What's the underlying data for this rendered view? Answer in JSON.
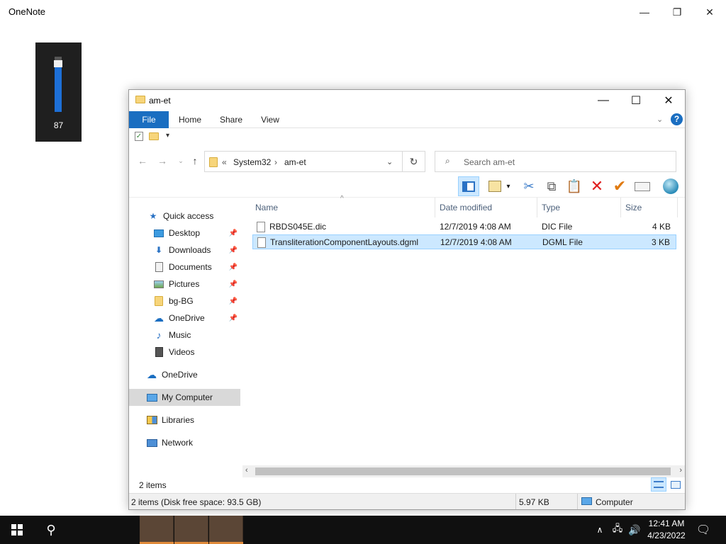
{
  "app": {
    "title": "OneNote"
  },
  "volume": {
    "level": 87,
    "label": "87"
  },
  "explorer": {
    "title": "am-et",
    "tabs": [
      "File",
      "Home",
      "Share",
      "View"
    ],
    "breadcrumb": {
      "overflow": "«",
      "items": [
        "System32",
        "am-et"
      ]
    },
    "search_placeholder": "Search am-et",
    "columns": [
      "Name",
      "Date modified",
      "Type",
      "Size"
    ],
    "nav": [
      {
        "label": "Quick access",
        "icon": "star-icon",
        "pinned": false
      },
      {
        "label": "Desktop",
        "icon": "desktop-icon",
        "pinned": true
      },
      {
        "label": "Downloads",
        "icon": "download-arrow-icon",
        "pinned": true
      },
      {
        "label": "Documents",
        "icon": "documents-icon",
        "pinned": true
      },
      {
        "label": "Pictures",
        "icon": "pictures-icon",
        "pinned": true
      },
      {
        "label": "bg-BG",
        "icon": "folder-icon",
        "pinned": true
      },
      {
        "label": "OneDrive",
        "icon": "cloud-icon",
        "pinned": true
      },
      {
        "label": "Music",
        "icon": "music-note-icon",
        "pinned": false
      },
      {
        "label": "Videos",
        "icon": "film-icon",
        "pinned": false
      },
      {
        "label": "OneDrive",
        "icon": "cloud-icon",
        "pinned": false
      },
      {
        "label": "My Computer",
        "icon": "computer-icon",
        "pinned": false,
        "selected": true
      },
      {
        "label": "Libraries",
        "icon": "libraries-icon",
        "pinned": false
      },
      {
        "label": "Network",
        "icon": "network-icon",
        "pinned": false
      }
    ],
    "files": [
      {
        "name": "RBDS045E.dic",
        "date": "12/7/2019 4:08 AM",
        "type": "DIC File",
        "size": "4 KB",
        "selected": false
      },
      {
        "name": "TransliterationComponentLayouts.dgml",
        "date": "12/7/2019 4:08 AM",
        "type": "DGML File",
        "size": "3 KB",
        "selected": true
      }
    ],
    "item_count": "2 items",
    "details": {
      "summary": "2 items (Disk free space: 93.5 GB)",
      "size": "5.97 KB",
      "location": "Computer"
    }
  },
  "taskbar": {
    "time": "12:41 AM",
    "date": "4/23/2022"
  },
  "colors": {
    "accent": "#1a6ec1",
    "selection": "#cce8ff",
    "taskbar": "#101010"
  }
}
